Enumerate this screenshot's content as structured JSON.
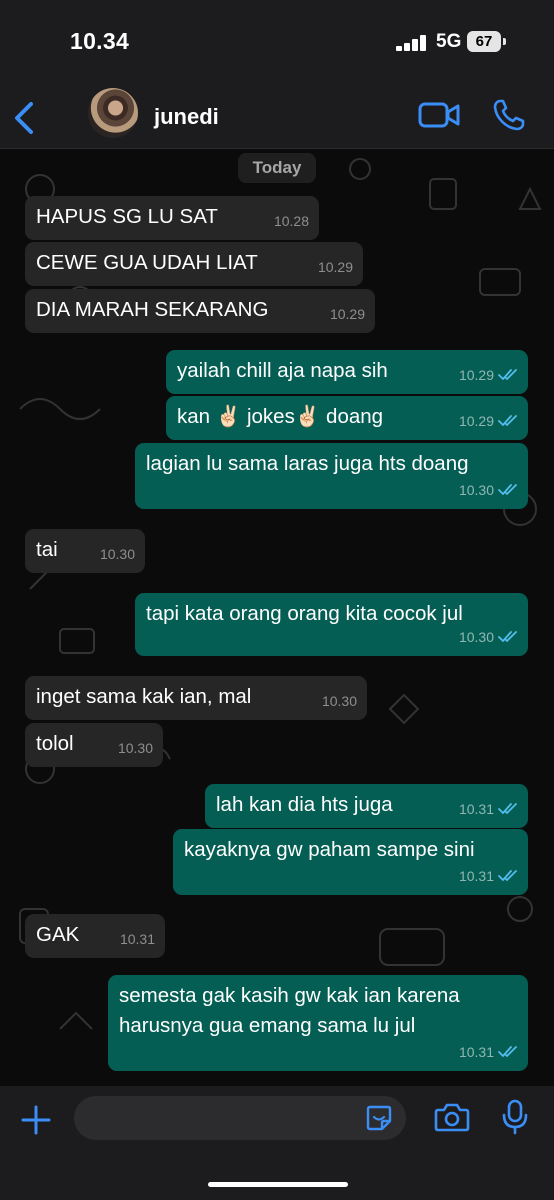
{
  "status_bar": {
    "time": "10.34",
    "network": "5G",
    "battery": "67"
  },
  "header": {
    "contact_name": "junedi"
  },
  "chat": {
    "date_label": "Today",
    "messages": [
      {
        "dir": "in",
        "lines": [
          "HAPUS SG LU SAT"
        ],
        "time": "10.28"
      },
      {
        "dir": "in",
        "lines": [
          "CEWE GUA UDAH LIAT"
        ],
        "time": "10.29"
      },
      {
        "dir": "in",
        "lines": [
          "DIA MARAH SEKARANG"
        ],
        "time": "10.29"
      },
      {
        "dir": "out",
        "lines": [
          "yailah chill aja napa sih"
        ],
        "time": "10.29"
      },
      {
        "dir": "out",
        "lines": [
          "kan ✌🏻 jokes✌🏻 doang"
        ],
        "time": "10.29"
      },
      {
        "dir": "out",
        "lines": [
          "lagian lu sama laras juga hts doang"
        ],
        "time": "10.30"
      },
      {
        "dir": "in",
        "lines": [
          "tai"
        ],
        "time": "10.30"
      },
      {
        "dir": "out",
        "lines": [
          "tapi kata orang orang kita cocok jul"
        ],
        "time": "10.30"
      },
      {
        "dir": "in",
        "lines": [
          "inget sama kak ian, mal"
        ],
        "time": "10.30"
      },
      {
        "dir": "in",
        "lines": [
          "tolol"
        ],
        "time": "10.30"
      },
      {
        "dir": "out",
        "lines": [
          "lah kan dia hts juga"
        ],
        "time": "10.31"
      },
      {
        "dir": "out",
        "lines": [
          "kayaknya gw paham sampe sini"
        ],
        "time": "10.31"
      },
      {
        "dir": "in",
        "lines": [
          "GAK"
        ],
        "time": "10.31"
      },
      {
        "dir": "out",
        "lines": [
          "semesta gak kasih gw kak ian karena",
          "harusnya gua emang sama lu jul"
        ],
        "time": "10.31"
      }
    ]
  },
  "composer": {
    "placeholder": ""
  },
  "icons": {
    "accent": "#3a8ef6",
    "read_tick": "#53bdeb",
    "names": [
      "back-chevron-icon",
      "video-call-icon",
      "phone-call-icon",
      "plus-icon",
      "sticker-icon",
      "camera-icon",
      "microphone-icon"
    ]
  }
}
